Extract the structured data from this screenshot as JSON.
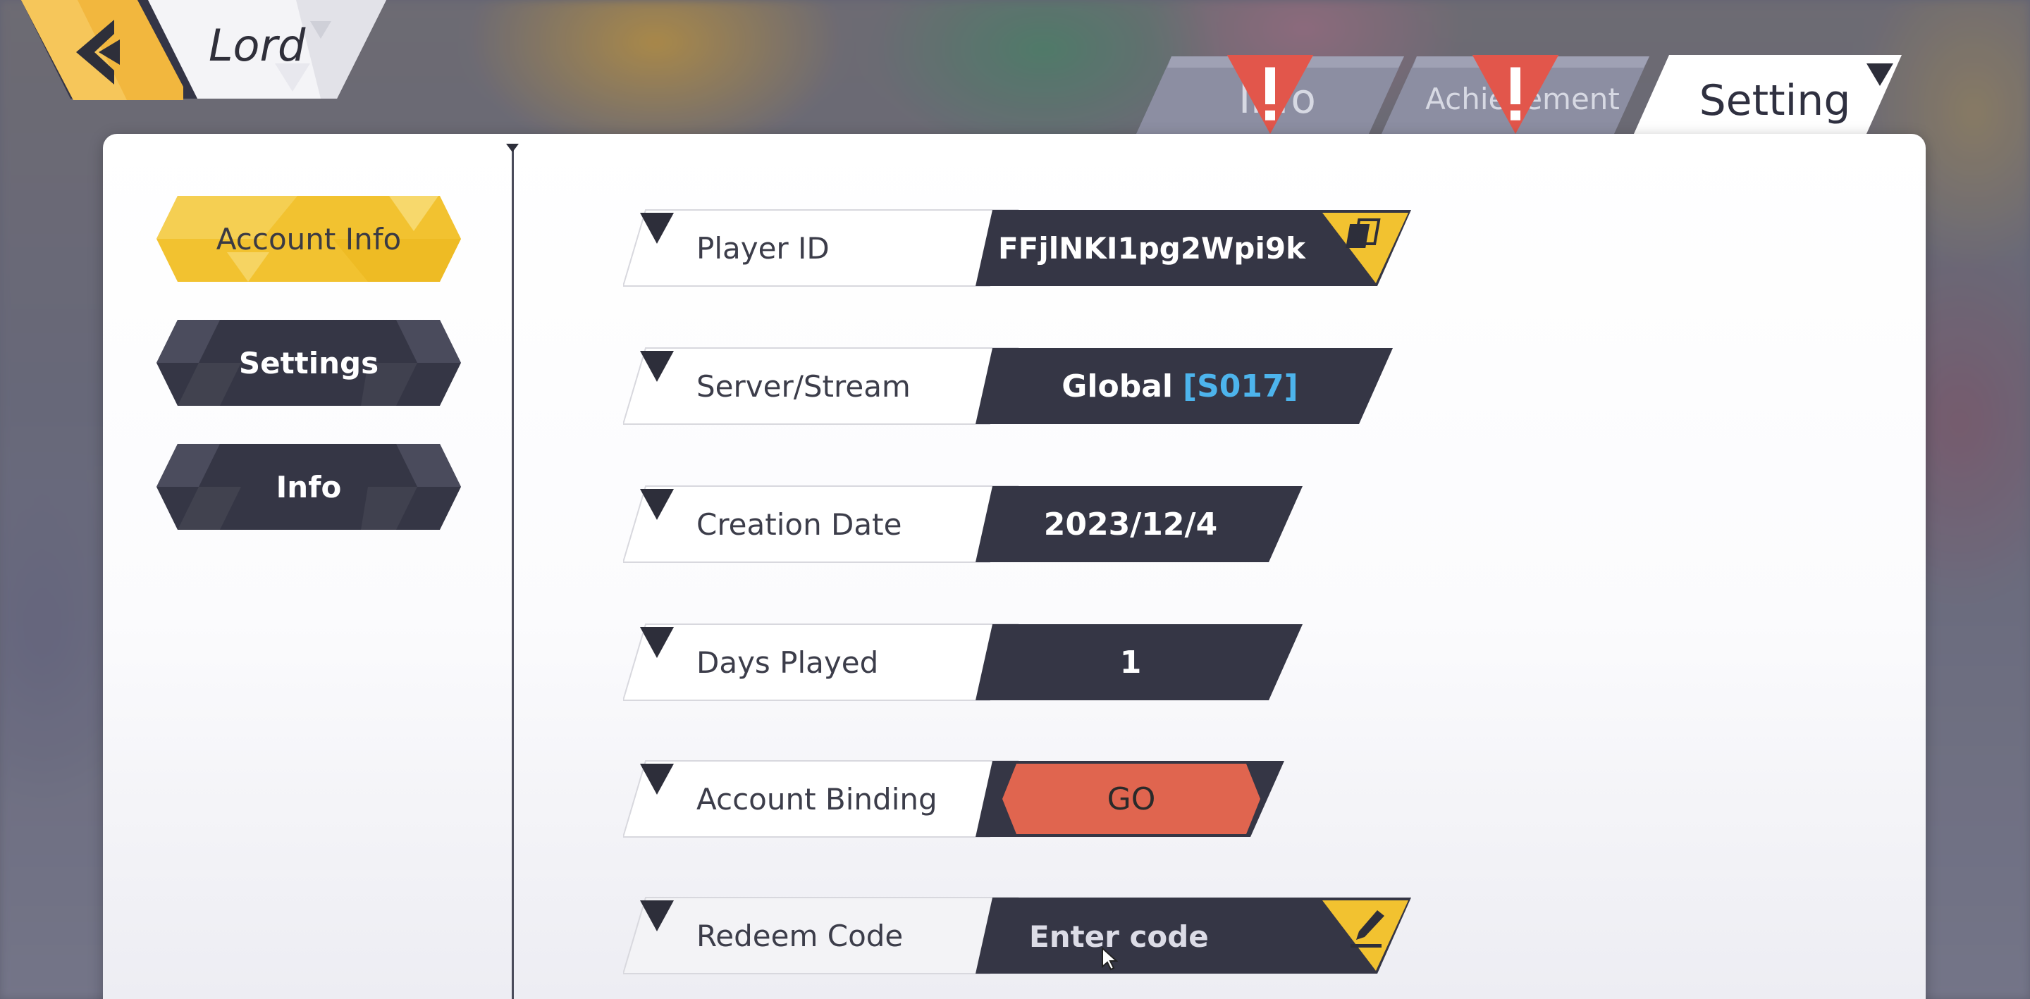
{
  "header": {
    "title": "Lord",
    "back_icon": "back-arrow-icon"
  },
  "tabs": [
    {
      "label": "Info",
      "active": false,
      "alert": true
    },
    {
      "label": "Achievement",
      "active": false,
      "alert": true
    },
    {
      "label": "Setting",
      "active": true,
      "alert": false
    }
  ],
  "sidebar": {
    "items": [
      {
        "label": "Account Info",
        "active": true
      },
      {
        "label": "Settings",
        "active": false
      },
      {
        "label": "Info",
        "active": false
      }
    ]
  },
  "account": {
    "player_id": {
      "label": "Player ID",
      "value": "FFjlNKI1pg2Wpi9k",
      "icon": "copy-icon"
    },
    "server": {
      "label": "Server/Stream",
      "value": "Global",
      "tag": "[S017]"
    },
    "creation_date": {
      "label": "Creation Date",
      "value": "2023/12/4"
    },
    "days_played": {
      "label": "Days Played",
      "value": "1"
    },
    "binding": {
      "label": "Account Binding",
      "button": "GO"
    },
    "redeem": {
      "label": "Redeem Code",
      "placeholder": "Enter code",
      "icon": "pencil-icon"
    }
  },
  "colors": {
    "accent_yellow": "#f2c230",
    "dark_slate": "#353645",
    "go_red": "#e0654f",
    "server_blue": "#4db4ec",
    "tab_inactive": "#8a8ca0",
    "alert_red": "#e2564b"
  }
}
